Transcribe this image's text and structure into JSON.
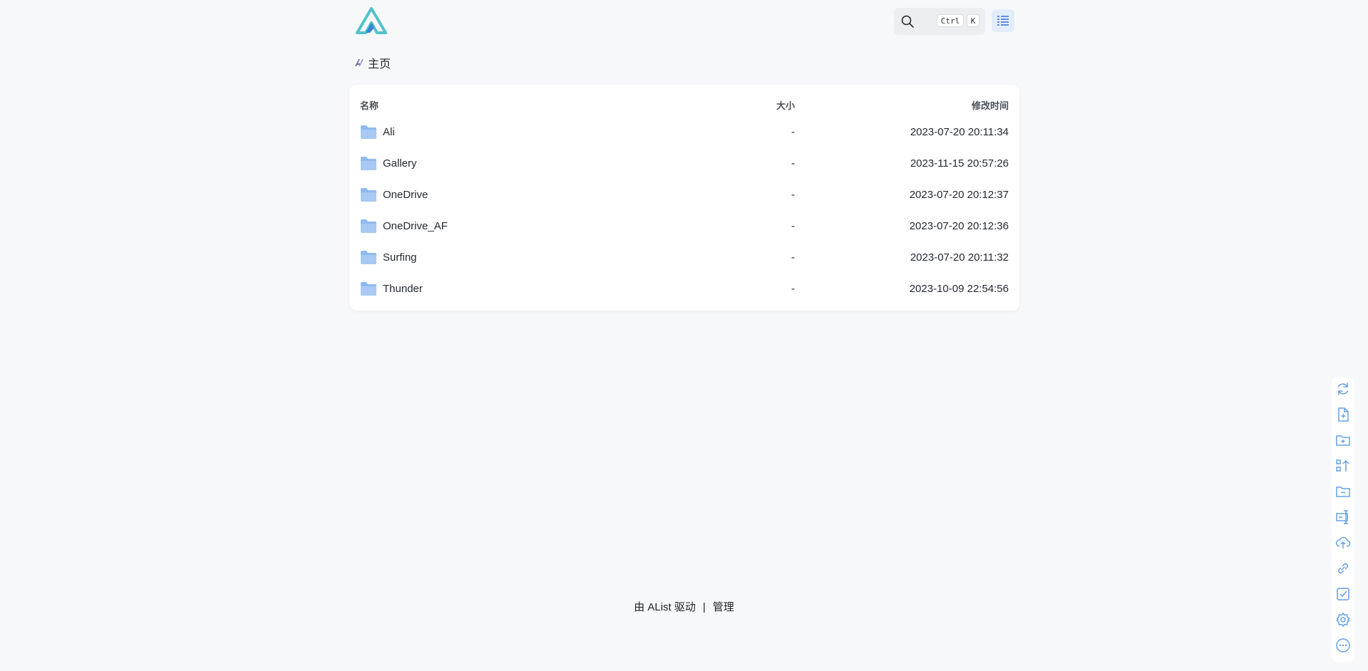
{
  "header": {
    "logo_icon": "alist-logo-icon",
    "search": {
      "icon": "search-icon",
      "key_ctrl": "Ctrl",
      "key_k": "K"
    },
    "layout_toggle_icon": "list-view-icon"
  },
  "breadcrumb": {
    "icon": "home-icon",
    "label": "主页"
  },
  "table": {
    "columns": {
      "name": "名称",
      "size": "大小",
      "modified": "修改时间"
    },
    "rows": [
      {
        "name": "Ali",
        "size": "-",
        "modified": "2023-07-20 20:11:34"
      },
      {
        "name": "Gallery",
        "size": "-",
        "modified": "2023-11-15 20:57:26"
      },
      {
        "name": "OneDrive",
        "size": "-",
        "modified": "2023-07-20 20:12:37"
      },
      {
        "name": "OneDrive_AF",
        "size": "-",
        "modified": "2023-07-20 20:12:36"
      },
      {
        "name": "Surfing",
        "size": "-",
        "modified": "2023-07-20 20:11:32"
      },
      {
        "name": "Thunder",
        "size": "-",
        "modified": "2023-10-09 22:54:56"
      }
    ]
  },
  "footer": {
    "powered_by": "由 AList 驱动",
    "separator": "|",
    "manage": "管理"
  },
  "toolbar_icons": [
    "refresh-icon",
    "new-file-icon",
    "new-folder-icon",
    "sort-icon",
    "folder-minus-icon",
    "rename-icon",
    "upload-icon",
    "link-icon",
    "checkbox-icon",
    "settings-icon",
    "more-icon"
  ],
  "colors": {
    "accent": "#64a0e6",
    "folder": "#8fbaf0",
    "logo_teal": "#52c2c8",
    "logo_blue": "#3a82d2"
  }
}
